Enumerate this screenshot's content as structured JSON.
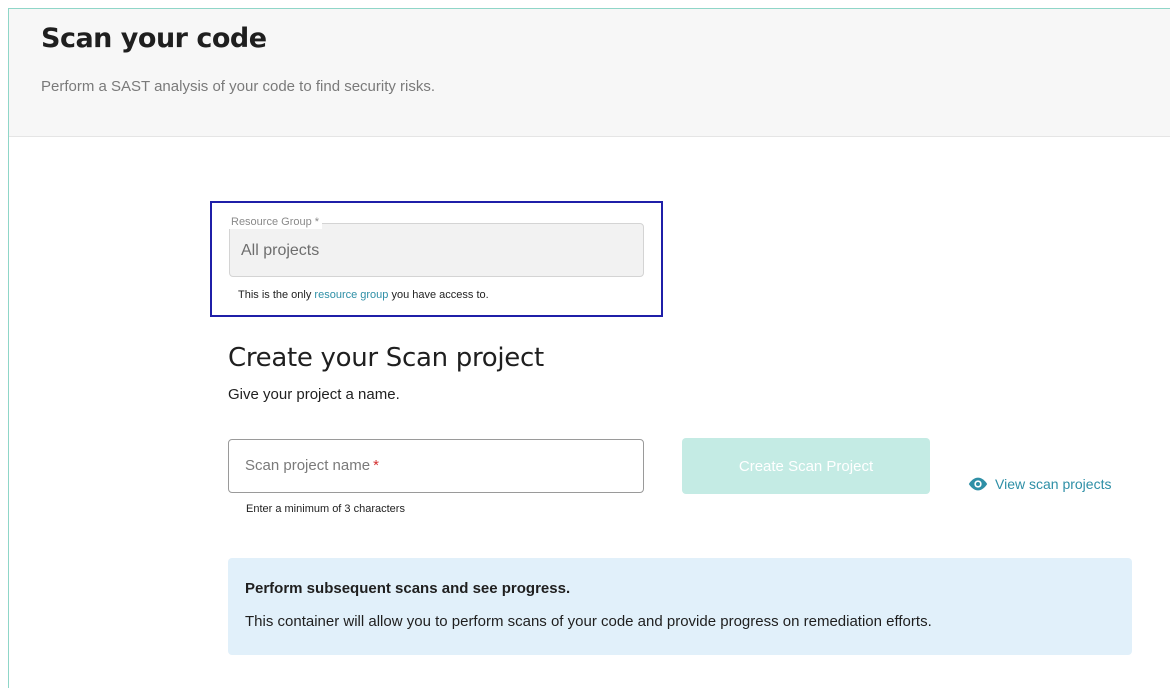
{
  "header": {
    "title": "Scan your code",
    "subtitle": "Perform a SAST analysis of your code to find security risks."
  },
  "resource_group": {
    "label": "Resource Group *",
    "value": "All projects",
    "help_prefix": "This is the only ",
    "help_link": "resource group",
    "help_suffix": " you have access to."
  },
  "create_section": {
    "title": "Create your Scan project",
    "subtitle": "Give your project a name."
  },
  "name_field": {
    "placeholder": "Scan project name",
    "required_mark": "*",
    "value": "",
    "help": "Enter a minimum of 3 characters"
  },
  "create_button": {
    "label": "Create Scan Project"
  },
  "view_link": {
    "label": "View scan projects",
    "icon": "eye-icon"
  },
  "info_box": {
    "title": "Perform subsequent scans and see progress.",
    "text": "This container will allow you to perform scans of your code and provide progress on remediation efforts."
  },
  "colors": {
    "accent": "#2e8fa6",
    "button_disabled": "#c4ebe4",
    "highlight_border": "#1f1fa8",
    "info_bg": "#e1f0fa",
    "required": "#d32f2f"
  }
}
